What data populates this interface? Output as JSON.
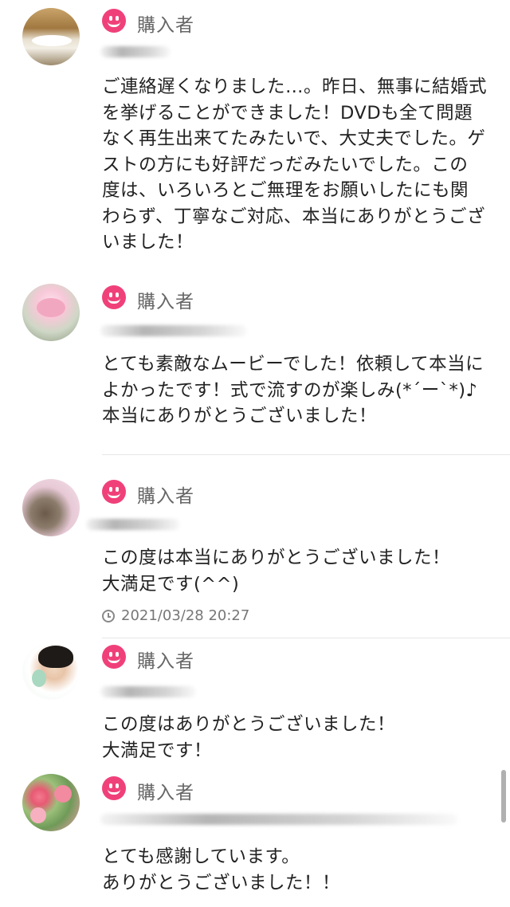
{
  "reviews": [
    {
      "role": "購入者",
      "body": "ご連絡遅くなりました…。昨日、無事に結婚式\nを挙げることができました！DVDも全て問題\nなく再生出来てたみたいで、大丈夫でした。ゲ\nストの方にも好評だっだみたいでした。この\n度は、いろいろとご無理をお願いしたにも関\nわらず、丁寧なご対応、本当にありがとうござ\nいました！",
      "date": ""
    },
    {
      "role": "購入者",
      "body": "とても素敵なムービーでした！依頼して本当に\nよかったです！式で流すのが楽しみ(*´ー`*)♪\n本当にありがとうございました！",
      "date": ""
    },
    {
      "role": "購入者",
      "body": "この度は本当にありがとうございました！\n大満足です(^^)",
      "date": "2021/03/28 20:27"
    },
    {
      "role": "購入者",
      "body": "この度はありがとうございました！\n大満足です！",
      "date": ""
    },
    {
      "role": "購入者",
      "body": "とても感謝しています。\nありがとうございました！！",
      "date": ""
    }
  ],
  "icons": {
    "badge": "smiley-face-icon",
    "date": "clock-icon"
  },
  "colors": {
    "badge": "#f0407a",
    "role_text": "#666666",
    "date_text": "#777777",
    "divider": "#e6e6e6"
  }
}
